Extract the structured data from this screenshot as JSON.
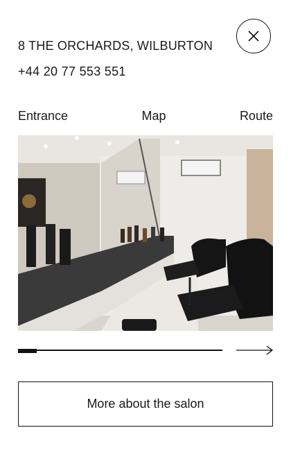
{
  "contact": {
    "address": "8 THE ORCHARDS, WILBURTON",
    "phone": "+44 20 77 553 551"
  },
  "tabs": [
    {
      "label": "Entrance"
    },
    {
      "label": "Map"
    },
    {
      "label": "Route"
    }
  ],
  "gallery": {
    "progress_fraction": 0.09
  },
  "buttons": {
    "more_label": "More about the salon"
  },
  "icons": {
    "close": "close-icon",
    "next": "arrow-right-icon"
  }
}
